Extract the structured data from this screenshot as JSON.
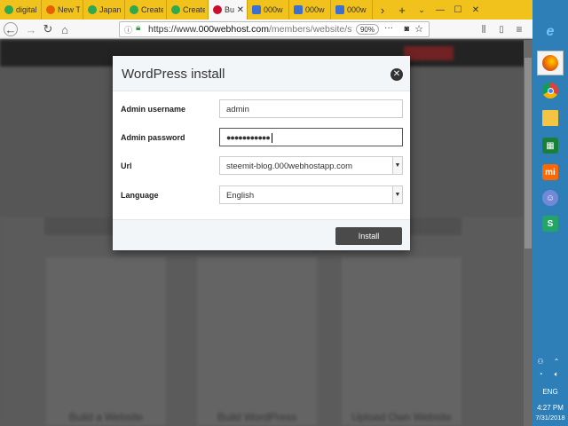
{
  "browser": {
    "tabs": [
      {
        "title": "digital",
        "icon": "globe-green-icon",
        "color": "#2fa84f"
      },
      {
        "title": "New T",
        "icon": "firefox-icon",
        "color": "#e66000"
      },
      {
        "title": "Japan",
        "icon": "globe-green-icon",
        "color": "#2fa84f"
      },
      {
        "title": "Create",
        "icon": "globe-green-icon",
        "color": "#2fa84f"
      },
      {
        "title": "Create",
        "icon": "globe-green-icon",
        "color": "#2fa84f"
      },
      {
        "title": "Bu",
        "icon": "steemit-icon",
        "color": "#c8102e",
        "active": true
      },
      {
        "title": "000w",
        "icon": "p-icon",
        "color": "#3b6fd1"
      },
      {
        "title": "000w",
        "icon": "p-icon",
        "color": "#3b6fd1"
      },
      {
        "title": "000w",
        "icon": "p-icon",
        "color": "#3b6fd1"
      }
    ],
    "url_prefix": "https://www.",
    "url_host": "000webhost.com",
    "url_path": "/members/website/stee",
    "zoom": "90%"
  },
  "modal": {
    "title": "WordPress install",
    "fields": [
      {
        "label": "Admin username",
        "value": "admin",
        "type": "text"
      },
      {
        "label": "Admin password",
        "value": "●●●●●●●●●●●",
        "type": "password"
      },
      {
        "label": "Url",
        "value": "steemit-blog.000webhostapp.com",
        "type": "select"
      },
      {
        "label": "Language",
        "value": "English",
        "type": "select"
      }
    ],
    "install_label": "Install"
  },
  "background_cards": [
    {
      "label": "Build a Website"
    },
    {
      "label": "Build WordPress"
    },
    {
      "label": "Upload Own Website"
    }
  ],
  "taskbar": {
    "apps": [
      {
        "name": "internet-explorer-icon",
        "color": "#1e90ff",
        "glyph": "e"
      },
      {
        "name": "firefox-icon",
        "color": "#e66000",
        "glyph": "",
        "active": true
      },
      {
        "name": "chrome-icon",
        "color": "#db4437",
        "glyph": ""
      },
      {
        "name": "file-explorer-icon",
        "color": "#f4c542",
        "glyph": ""
      },
      {
        "name": "store-icon",
        "color": "#188038",
        "glyph": ""
      },
      {
        "name": "mi-icon",
        "color": "#ff6700",
        "glyph": "mi"
      },
      {
        "name": "discord-icon",
        "color": "#7289da",
        "glyph": ""
      },
      {
        "name": "sheets-icon",
        "color": "#23a566",
        "glyph": "S"
      }
    ],
    "language": "ENG",
    "time": "4:27 PM",
    "date": "7/31/2018"
  }
}
